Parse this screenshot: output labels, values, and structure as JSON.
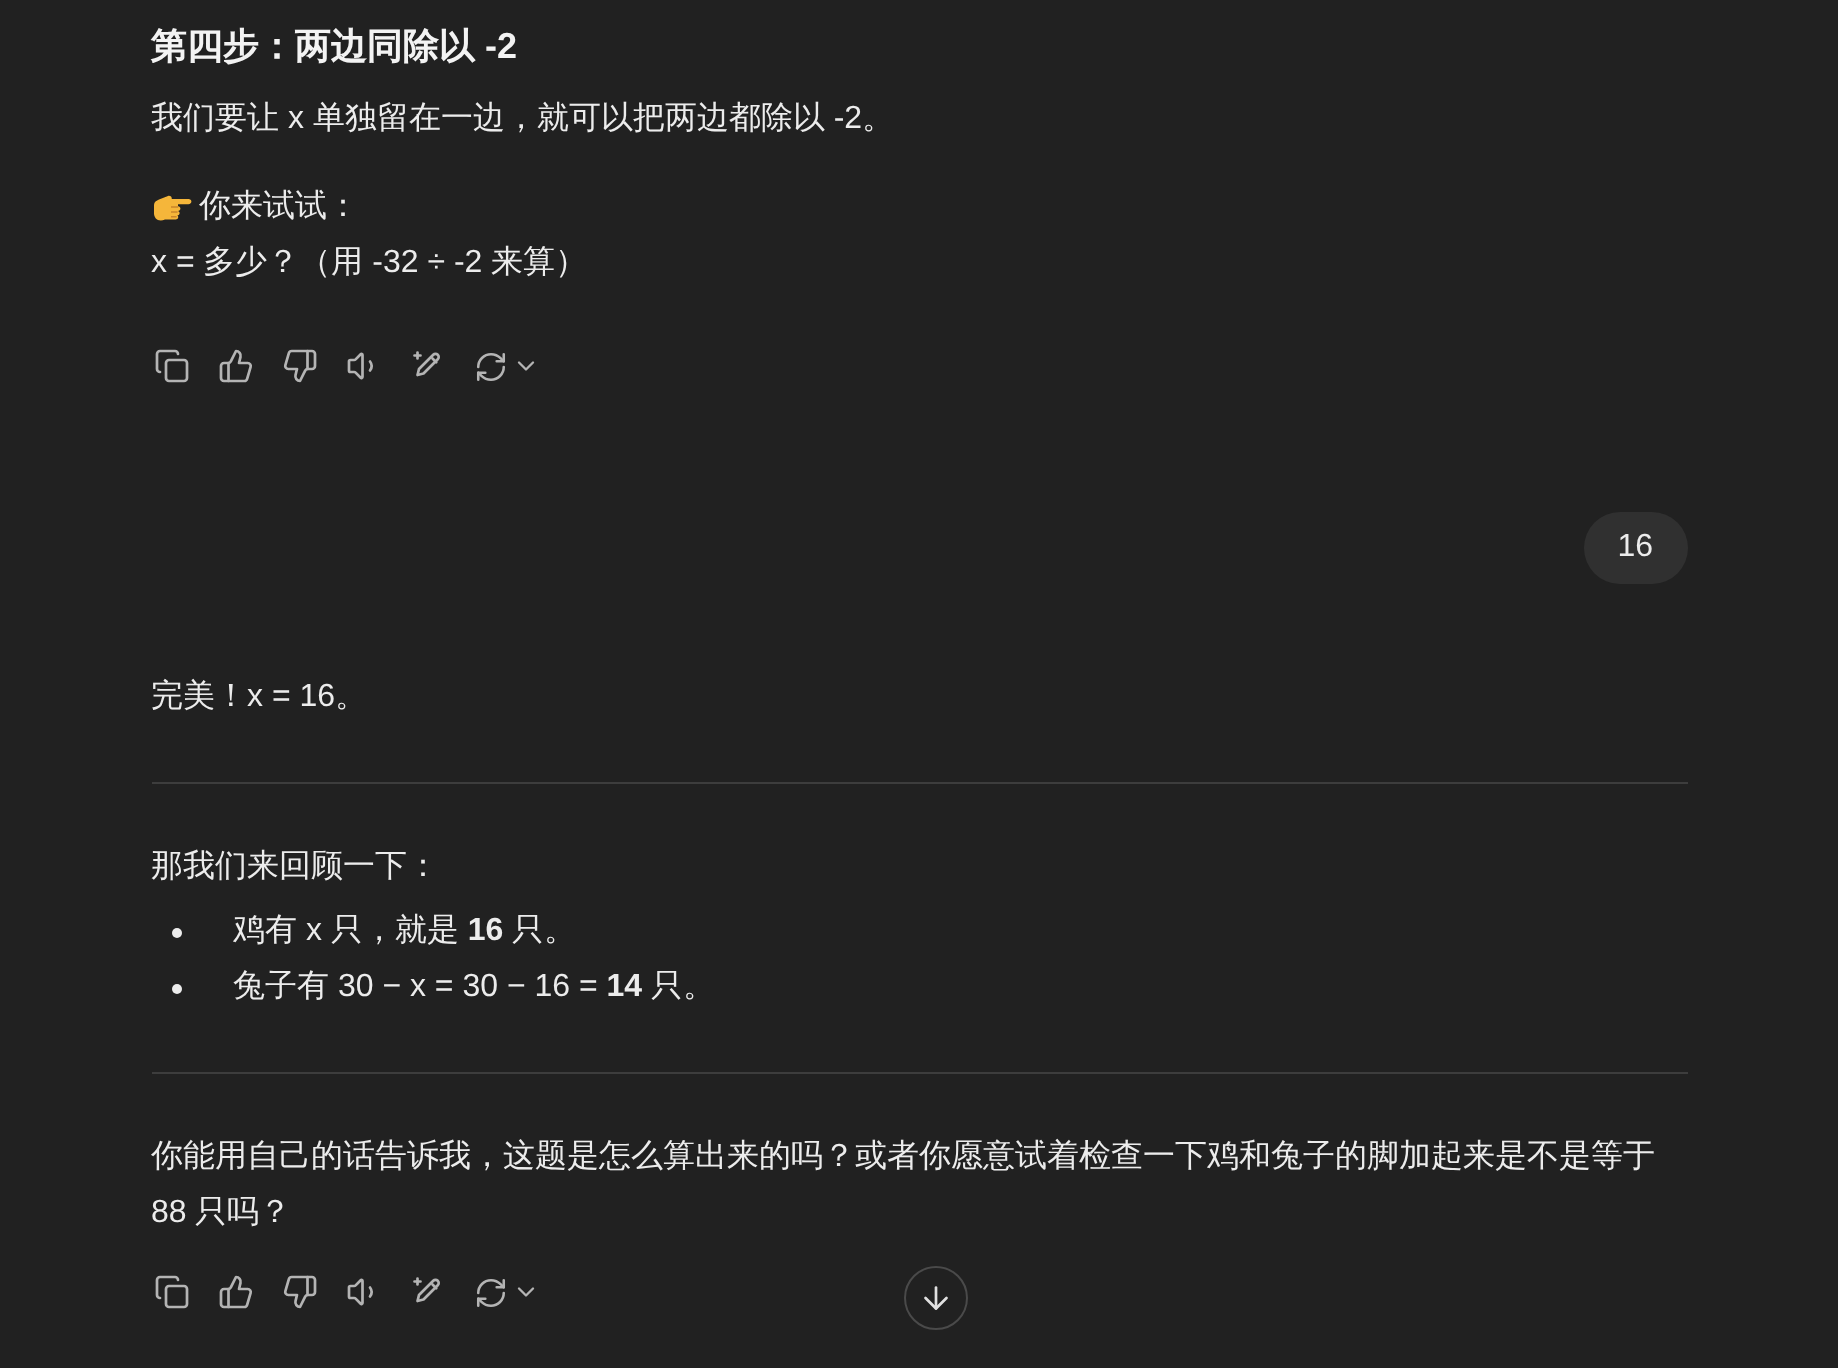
{
  "messages": [
    {
      "kind": "assistant",
      "show_actions": true,
      "blocks": [
        {
          "kind": "heading",
          "text": "第四步：两边同除以 -2"
        },
        {
          "kind": "paragraph",
          "lines": [
            {
              "kind": "plain",
              "text": "我们要让 x 单独留在一边，就可以把两边都除以 -2。"
            }
          ]
        },
        {
          "kind": "paragraph",
          "lines": [
            {
              "kind": "prompt",
              "text": "你来试试："
            },
            {
              "kind": "plain",
              "text": "x = 多少？（用 -32 ÷ -2 来算）"
            }
          ]
        }
      ]
    },
    {
      "kind": "user",
      "text": "16"
    },
    {
      "kind": "assistant",
      "show_actions": true,
      "blocks": [
        {
          "kind": "paragraph",
          "lines": [
            {
              "kind": "plain",
              "text": "完美！x = 16。"
            }
          ]
        },
        {
          "kind": "divider"
        },
        {
          "kind": "paragraph",
          "lines": [
            {
              "kind": "plain",
              "text": "那我们来回顾一下："
            }
          ]
        },
        {
          "kind": "list",
          "items": [
            "鸡有 x 只，就是 **16** 只。",
            "兔子有 30 − x = 30 − 16 = **14** 只。"
          ]
        },
        {
          "kind": "divider"
        },
        {
          "kind": "paragraph",
          "lines": [
            {
              "kind": "plain",
              "text": "你能用自己的话告诉我，这题是怎么算出来的吗？或者你愿意试着检查一下鸡和兔子的脚加起来是不是等于 88 只吗？"
            }
          ]
        }
      ]
    }
  ],
  "scroll_down_button": true
}
